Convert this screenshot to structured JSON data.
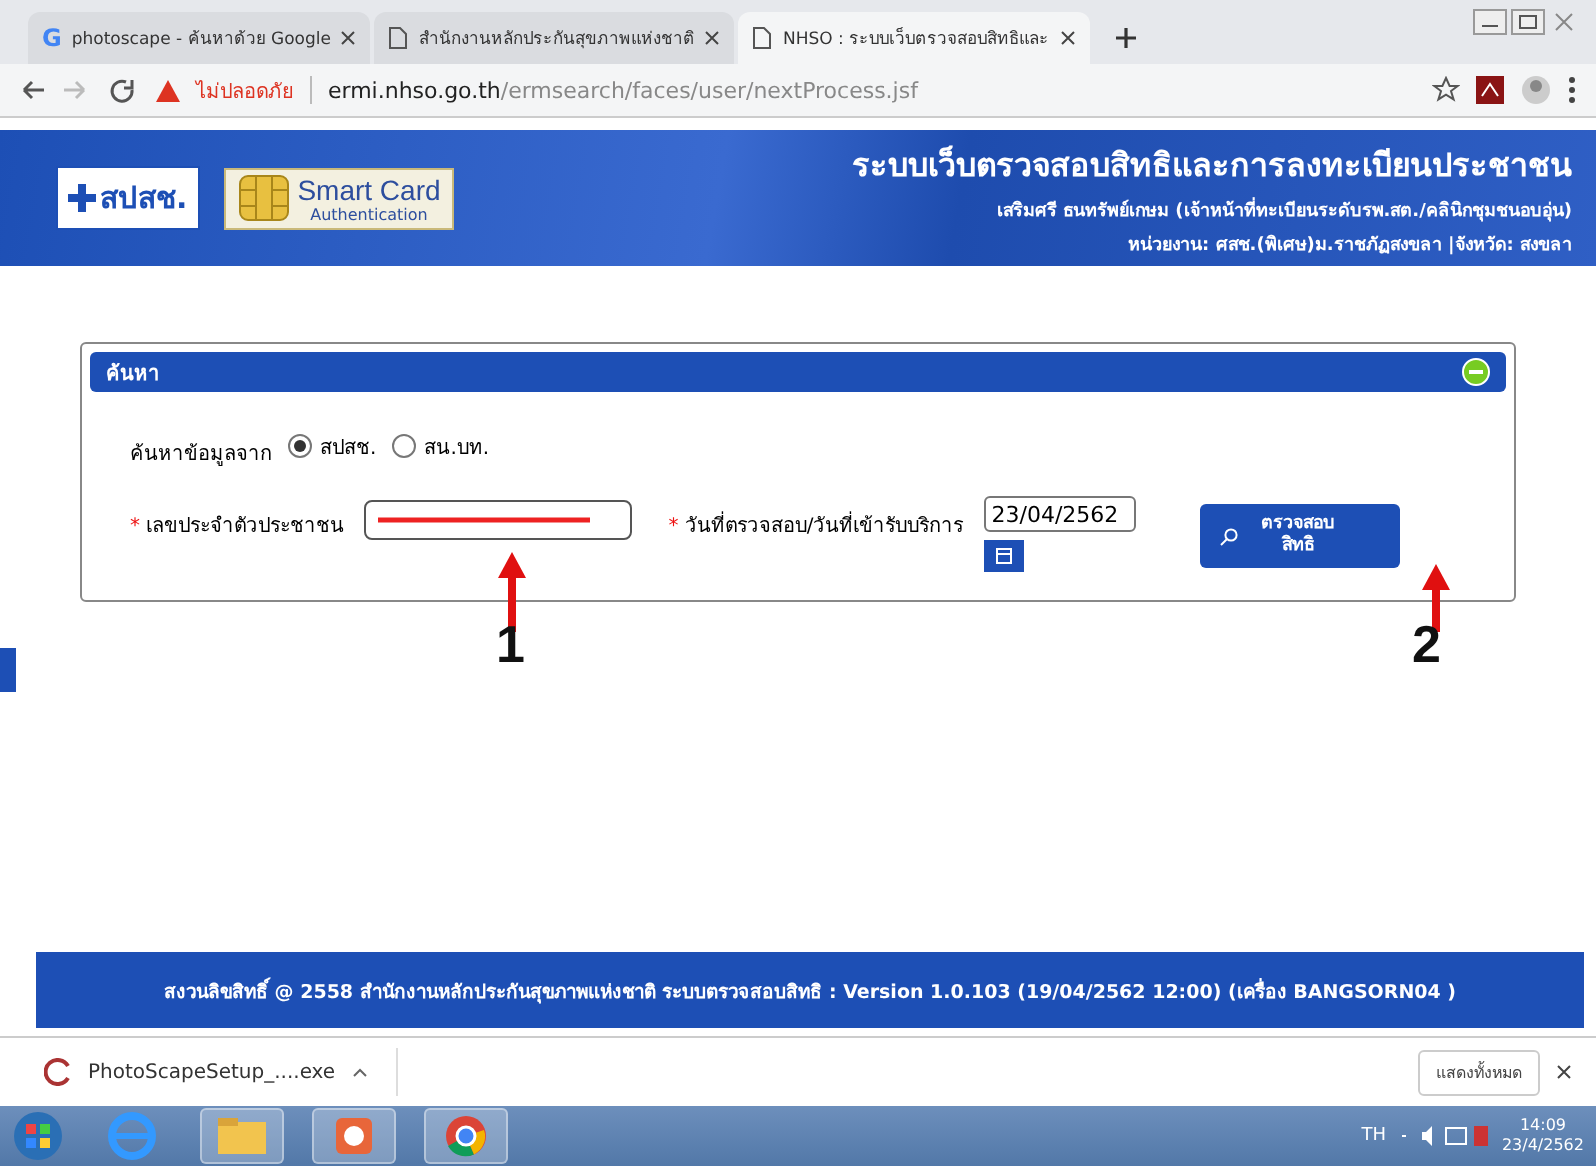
{
  "browser": {
    "tabs": [
      {
        "title": "photoscape - ค้นหาด้วย Google",
        "kind": "google",
        "icon_text": "G",
        "selected": false
      },
      {
        "title": "สำนักงานหลักประกันสุขภาพแห่งชาติ",
        "kind": "page",
        "selected": false
      },
      {
        "title": "NHSO : ระบบเว็บตรวจสอบสิทธิและ",
        "kind": "page",
        "selected": true
      }
    ],
    "security": "ไม่ปลอดภัย",
    "url_host": "ermi.nhso.go.th",
    "url_path": "/ermsearch/faces/user/nextProcess.jsf"
  },
  "header": {
    "logo_text": "สปสช.",
    "smartcard_title": "Smart Card",
    "smartcard_sub": "Authentication",
    "title": "ระบบเว็บตรวจสอบสิทธิและการลงทะเบียนประชาชน",
    "user": "เสริมศรี ธนทรัพย์เกษม (เจ้าหน้าที่ทะเบียนระดับรพ.สต./คลินิกชุมชนอบอุ่น)",
    "unit": "หน่วยงาน: ศสช.(พิเศษ)ม.ราชภัฏสงขลา |จังหวัด: สงขลา"
  },
  "search_panel": {
    "title": "ค้นหา",
    "expanded": true,
    "source_label": "ค้นหาข้อมูลจาก",
    "sources": [
      {
        "label": "สปสช.",
        "selected": true
      },
      {
        "label": "สน.บท.",
        "selected": false
      }
    ],
    "required_mark": "*",
    "id_label": "เลขประจำตัวประชาชน",
    "id_redacted": true,
    "date_label": "วันที่ตรวจสอบ/วันที่เข้ารับบริการ",
    "date_value": "23/04/2562",
    "check_button": "ตรวจสอบสิทธิ"
  },
  "annotations": [
    {
      "number": "1"
    },
    {
      "number": "2"
    }
  ],
  "footer": "สงวนลิขสิทธิ์ @ 2558 สำนักงานหลักประกันสุขภาพแห่งชาติ ระบบตรวจสอบสิทธิ : Version 1.0.103 (19/04/2562 12:00) (เครื่อง  BANGSORN04 )",
  "download_bar": {
    "file": "PhotoScapeSetup_....exe",
    "show_all": "แสดงทั้งหมด"
  },
  "taskbar": {
    "language": "TH",
    "time": "14:09",
    "date": "23/4/2562"
  }
}
